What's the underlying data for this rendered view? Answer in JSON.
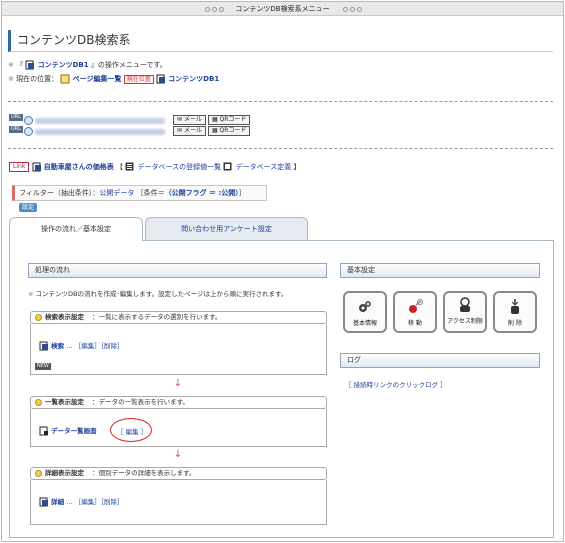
{
  "window": {
    "title": "コンテンツDB検索系メニュー"
  },
  "page": {
    "title": "コンテンツDB検索系"
  },
  "intro": {
    "line1_prefix": "『",
    "line1_link": "コンテンツDB1",
    "line1_suffix": "』の操作メニューです。",
    "location_label": "現在の位置：",
    "location_page": "ページ編集一覧",
    "location_badge": "現在位置",
    "location_link": "コンテンツDB1"
  },
  "urls": [
    {
      "tag": "URL",
      "mail": "メール",
      "qr": "QRコード"
    },
    {
      "tag": "URL",
      "mail": "メール",
      "qr": "QRコード"
    }
  ],
  "related": {
    "link_button": "Link",
    "title": "自動車屋さんの価格表",
    "db_list": "データベースの登録値一覧",
    "db_def": "データベース定義"
  },
  "filter": {
    "label": "フィルター（抽出条件）：",
    "value": "公開データ",
    "condition_prefix": "［条件＝",
    "condition": "（公開フラグ ＝ :公開）",
    "condition_suffix": "］",
    "set_button": "設定"
  },
  "tabs": [
    {
      "label": "操作の流れ／基本設定",
      "active": true
    },
    {
      "label": "問い合わせ用アンケート設定",
      "active": false
    }
  ],
  "flow": {
    "header": "処理の流れ",
    "description": "コンテンツDBの流れを作成･編集します。設定したページは上から順に実行されます。",
    "steps": [
      {
        "title": "検索表示設定",
        "desc": "一覧に表示するデータの選別を行います。",
        "page_link": "検索",
        "actions": [
          "編集",
          "削除"
        ],
        "new_badge": "NEW"
      },
      {
        "title": "一覧表示設定",
        "desc": "データの一覧表示を行います。",
        "page_link": "データ一覧画面",
        "actions": [
          "編集"
        ]
      },
      {
        "title": "詳細表示設定",
        "desc": "個別データの詳細を表示します。",
        "page_link": "詳細",
        "actions": [
          "編集",
          "削除"
        ]
      }
    ],
    "arrow": "↓"
  },
  "basic": {
    "header": "基本設定",
    "buttons": [
      {
        "label": "基本情報",
        "icon": "gears-icon"
      },
      {
        "label": "移 動",
        "icon": "move-icon"
      },
      {
        "label": "アクセス制限",
        "icon": "access-icon"
      },
      {
        "label": "削 除",
        "icon": "delete-icon"
      }
    ]
  },
  "log": {
    "header": "ログ",
    "link": "［ 接続時リンクのクリックログ ］"
  },
  "colors": {
    "accent": "#2d6b9e",
    "link": "#1a3f9a",
    "highlight": "#dd2222"
  }
}
